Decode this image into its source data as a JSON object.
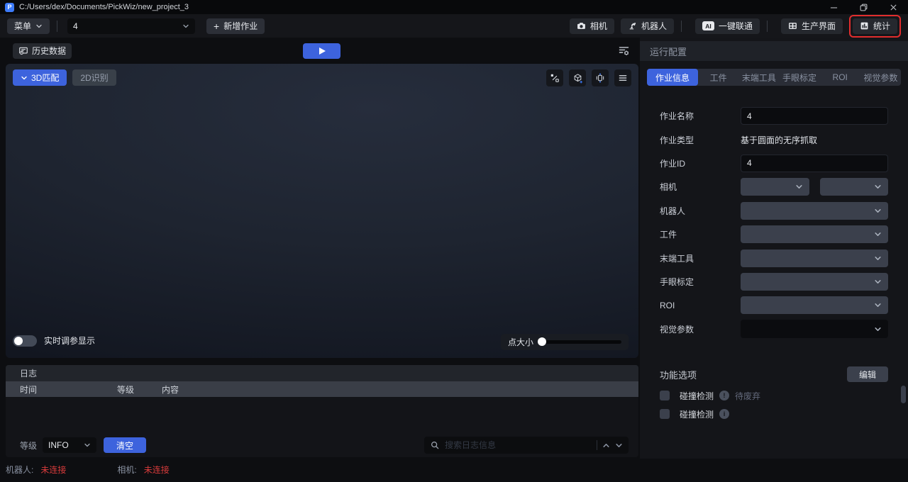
{
  "window": {
    "title": "C:/Users/dex/Documents/PickWiz/new_project_3",
    "app_icon_glyph": "P"
  },
  "toolbar": {
    "menu_label": "菜单",
    "job_select_value": "4",
    "new_job_label": "新增作业",
    "camera_label": "相机",
    "robot_label": "机器人",
    "ai_badge": "AI",
    "one_key_label": "一键联通",
    "production_label": "生产界面",
    "stats_label": "统计"
  },
  "viewport": {
    "history_label": "历史数据",
    "tab_3d_label": "3D匹配",
    "tab_2d_label": "2D识别",
    "realtime_toggle_label": "实时调参显示",
    "realtime_toggle_state": "off",
    "point_size_label": "点大小"
  },
  "log": {
    "title": "日志",
    "columns": [
      "时间",
      "等级",
      "内容"
    ],
    "rows": [],
    "level_label": "等级",
    "level_value": "INFO",
    "clear_label": "清空",
    "search_placeholder": "搜索日志信息"
  },
  "config": {
    "title": "运行配置",
    "tabs": [
      "作业信息",
      "工件",
      "末端工具",
      "手眼标定",
      "ROI",
      "视觉参数"
    ],
    "active_tab": "作业信息",
    "fields": [
      {
        "label": "作业名称",
        "type": "input",
        "value": "4"
      },
      {
        "label": "作业类型",
        "type": "text",
        "value": "基于圆面的无序抓取"
      },
      {
        "label": "作业ID",
        "type": "input",
        "value": "4"
      },
      {
        "label": "相机",
        "type": "dual-select",
        "value": ""
      },
      {
        "label": "机器人",
        "type": "select",
        "value": ""
      },
      {
        "label": "工件",
        "type": "select",
        "value": ""
      },
      {
        "label": "末端工具",
        "type": "select",
        "value": ""
      },
      {
        "label": "手眼标定",
        "type": "select",
        "value": ""
      },
      {
        "label": "ROI",
        "type": "select",
        "value": ""
      },
      {
        "label": "视觉参数",
        "type": "select",
        "value": ""
      }
    ],
    "options": {
      "title": "功能选项",
      "edit_label": "编辑",
      "items": [
        {
          "label": "碰撞检测",
          "glyph": "!",
          "note": "待废弃",
          "checked": false
        },
        {
          "label": "碰撞检测",
          "glyph": "i",
          "note": "",
          "checked": false
        }
      ]
    }
  },
  "status_bar": {
    "robot_label": "机器人:",
    "robot_value": "未连接",
    "camera_label": "相机:",
    "camera_value": "未连接"
  },
  "colors": {
    "accent_blue": "#3d63dd",
    "highlight_red": "#e12d2d",
    "status_red": "#d83b3b",
    "panel_bg": "#141519"
  }
}
